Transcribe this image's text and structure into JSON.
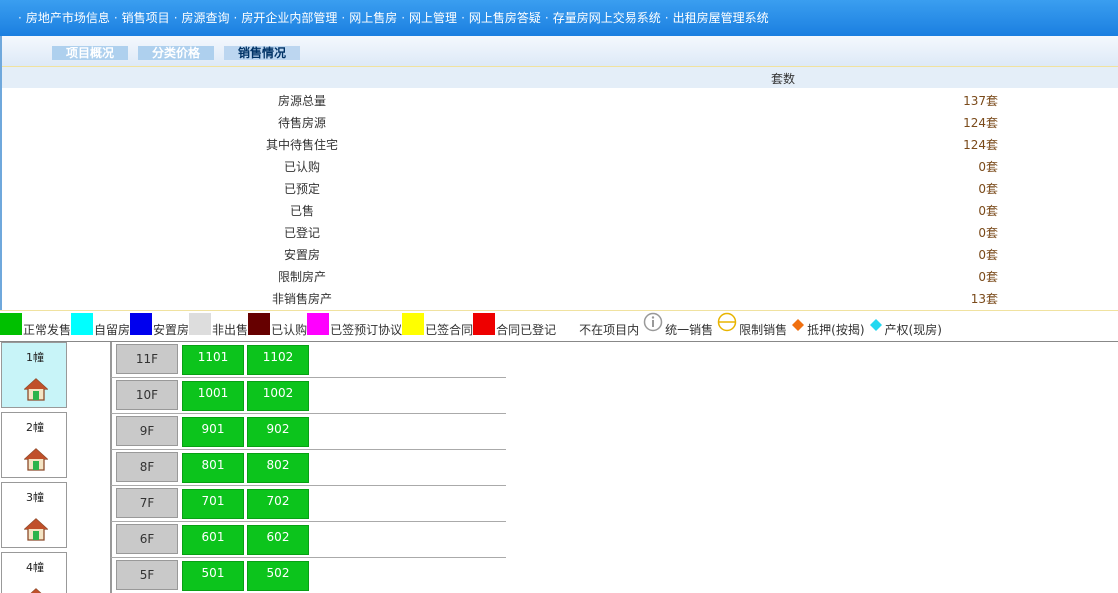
{
  "nav": {
    "items": [
      "房地产市场信息",
      "销售项目",
      "房源查询",
      "房开企业内部管理",
      "网上售房",
      "网上管理",
      "网上售房答疑",
      "存量房网上交易系统",
      "出租房屋管理系统"
    ]
  },
  "tabs": [
    {
      "label": "项目概况"
    },
    {
      "label": "分类价格"
    },
    {
      "label": "销售情况"
    }
  ],
  "sales": {
    "column_header": "套数",
    "rows": [
      {
        "label": "房源总量",
        "value": "137套"
      },
      {
        "label": "待售房源",
        "value": "124套"
      },
      {
        "label": "其中待售住宅",
        "value": "124套"
      },
      {
        "label": "已认购",
        "value": "0套"
      },
      {
        "label": "已预定",
        "value": "0套"
      },
      {
        "label": "已售",
        "value": "0套"
      },
      {
        "label": "已登记",
        "value": "0套"
      },
      {
        "label": "安置房",
        "value": "0套"
      },
      {
        "label": "限制房产",
        "value": "0套"
      },
      {
        "label": "非销售房产",
        "value": "13套"
      }
    ]
  },
  "legend": [
    {
      "label": "正常发售",
      "color": "#00c000",
      "kind": "swatch"
    },
    {
      "label": "自留房",
      "color": "#00ffff",
      "kind": "swatch"
    },
    {
      "label": "安置房",
      "color": "#0000ee",
      "kind": "swatch"
    },
    {
      "label": "非出售",
      "color": "#dddddd",
      "kind": "swatch"
    },
    {
      "label": "已认购",
      "color": "#660000",
      "kind": "swatch"
    },
    {
      "label": "已签预订协议",
      "color": "#ff00ff",
      "kind": "swatch"
    },
    {
      "label": "已签合同",
      "color": "#ffff00",
      "kind": "swatch"
    },
    {
      "label": "合同已登记",
      "color": "#ee0000",
      "kind": "swatch"
    },
    {
      "label": "不在项目内",
      "color": "#ffffff",
      "kind": "swatch"
    },
    {
      "label": "统一销售",
      "icon": "info-circle-icon",
      "kind": "symbol"
    },
    {
      "label": "限制销售",
      "icon": "restricted-circle-icon",
      "kind": "symbol"
    },
    {
      "label": "抵押(按揭)",
      "icon": "orange-diamond-icon",
      "kind": "symbol"
    },
    {
      "label": "产权(现房)",
      "icon": "cyan-diamond-icon",
      "kind": "symbol"
    }
  ],
  "buildings": [
    {
      "label": "1幢",
      "active": true
    },
    {
      "label": "2幢",
      "active": false
    },
    {
      "label": "3幢",
      "active": false
    },
    {
      "label": "4幢",
      "active": false
    }
  ],
  "floors": [
    {
      "label": "11F",
      "units": [
        "1101",
        "1102"
      ]
    },
    {
      "label": "10F",
      "units": [
        "1001",
        "1002"
      ]
    },
    {
      "label": "9F",
      "units": [
        "901",
        "902"
      ]
    },
    {
      "label": "8F",
      "units": [
        "801",
        "802"
      ]
    },
    {
      "label": "7F",
      "units": [
        "701",
        "702"
      ]
    },
    {
      "label": "6F",
      "units": [
        "601",
        "602"
      ]
    },
    {
      "label": "5F",
      "units": [
        "501",
        "502"
      ]
    }
  ],
  "colors": {
    "unit_available": "#0cc41c",
    "nav_bg": "#1b7fe0",
    "selected_building": "#c8f4f8"
  }
}
